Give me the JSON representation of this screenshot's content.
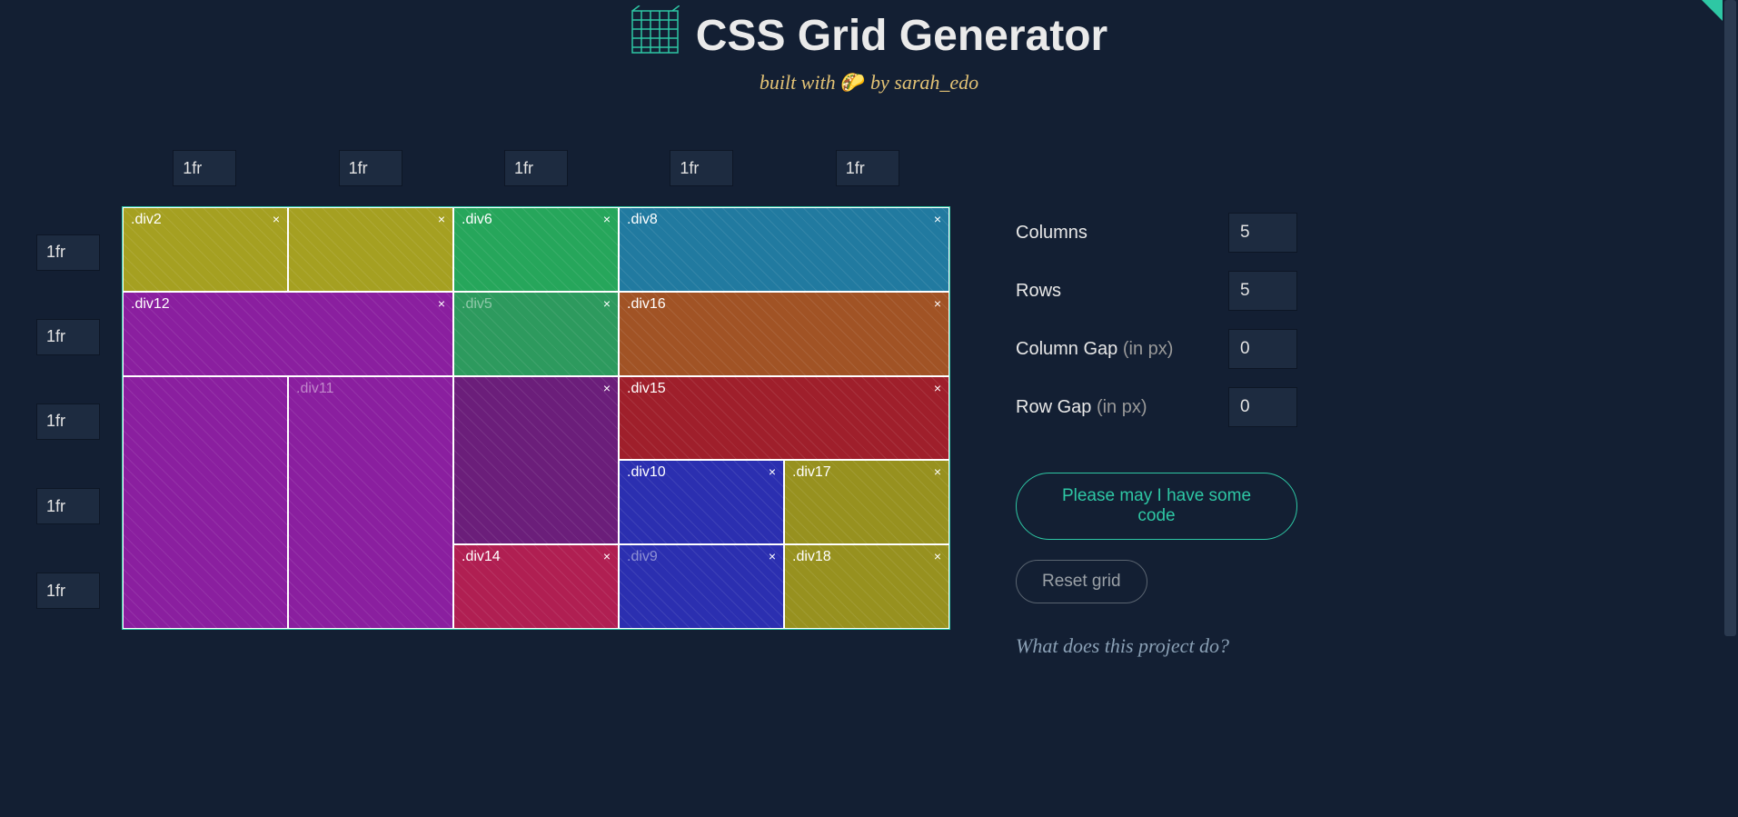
{
  "header": {
    "title": "CSS Grid Generator",
    "subtitle_prefix": "built with ",
    "subtitle_emoji": "🌮",
    "subtitle_by": " by ",
    "subtitle_author": "sarah_edo"
  },
  "columns": [
    "1fr",
    "1fr",
    "1fr",
    "1fr",
    "1fr"
  ],
  "rows": [
    "1fr",
    "1fr",
    "1fr",
    "1fr",
    "1fr"
  ],
  "divs": {
    "div2": {
      "label": ".div2",
      "faded": false
    },
    "div2b": {
      "label": "",
      "faded": false
    },
    "div6": {
      "label": ".div6",
      "faded": false
    },
    "div8": {
      "label": ".div8",
      "faded": false
    },
    "div12": {
      "label": ".div12",
      "faded": false
    },
    "div5": {
      "label": ".div5",
      "faded": true
    },
    "div16": {
      "label": ".div16",
      "faded": false
    },
    "div11": {
      "label": ".div11",
      "faded": true
    },
    "div11b": {
      "label": "",
      "faded": false
    },
    "div15": {
      "label": ".div15",
      "faded": false
    },
    "div10": {
      "label": ".div10",
      "faded": false
    },
    "div17": {
      "label": ".div17",
      "faded": false
    },
    "div14": {
      "label": ".div14",
      "faded": false
    },
    "div9": {
      "label": ".div9",
      "faded": true
    },
    "div18": {
      "label": ".div18",
      "faded": false
    }
  },
  "controls": {
    "columns_label": "Columns",
    "columns_value": "5",
    "rows_label": "Rows",
    "rows_value": "5",
    "colgap_label": "Column Gap ",
    "colgap_hint": "(in px)",
    "colgap_value": "0",
    "rowgap_label": "Row Gap ",
    "rowgap_hint": "(in px)",
    "rowgap_value": "0",
    "code_button": "Please may I have some code",
    "reset_button": "Reset grid",
    "help_link": "What does this project do?"
  },
  "close_glyph": "×"
}
